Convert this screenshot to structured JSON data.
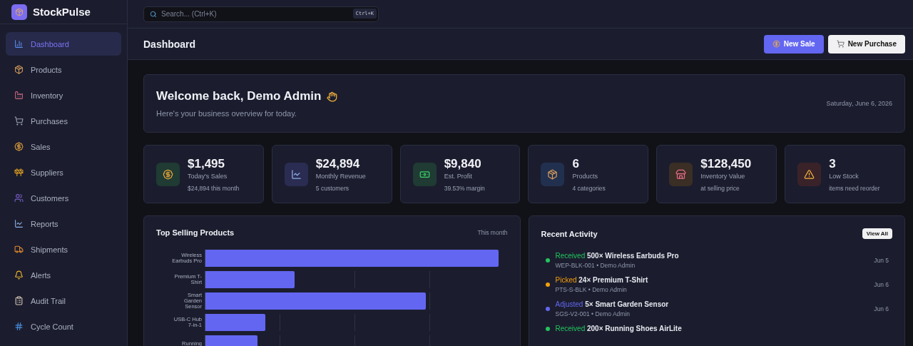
{
  "app": {
    "name": "StockPulse"
  },
  "sidebar": {
    "items": [
      {
        "label": "Dashboard",
        "selected": true
      },
      {
        "label": "Products",
        "selected": false
      },
      {
        "label": "Inventory",
        "selected": false
      },
      {
        "label": "Purchases",
        "selected": false
      },
      {
        "label": "Sales",
        "selected": false
      },
      {
        "label": "Suppliers",
        "selected": false
      },
      {
        "label": "Customers",
        "selected": false
      },
      {
        "label": "Reports",
        "selected": false
      },
      {
        "label": "Shipments",
        "selected": false
      },
      {
        "label": "Alerts",
        "selected": false
      },
      {
        "label": "Audit Trail",
        "selected": false
      },
      {
        "label": "Cycle Count",
        "selected": false
      }
    ]
  },
  "search": {
    "placeholder": "Search... (Ctrl+K)",
    "shortcut": "Ctrl+K"
  },
  "header": {
    "title": "Dashboard",
    "buttons": [
      {
        "label": "New Sale",
        "kind": "primary"
      },
      {
        "label": "New Purchase",
        "kind": "secondary"
      }
    ]
  },
  "welcome": {
    "title": "Welcome back, Demo Admin",
    "subtitle": "Here's your business overview for today.",
    "date": "Saturday, June 6, 2026"
  },
  "stats": [
    {
      "value": "$1,495",
      "label": "Today's Sales",
      "note": "$24,894 this month",
      "color": "#1f3b33"
    },
    {
      "value": "$24,894",
      "label": "Monthly Revenue",
      "note": "5 customers",
      "color": "#2a2c52"
    },
    {
      "value": "$9,840",
      "label": "Est. Profit",
      "note": "39.53% margin",
      "color": "#1f3b33"
    },
    {
      "value": "6",
      "label": "Products",
      "note": "4 categories",
      "color": "#22304f"
    },
    {
      "value": "$128,450",
      "label": "Inventory Value",
      "note": "at selling price",
      "color": "#3a2e25"
    },
    {
      "value": "3",
      "label": "Low Stock",
      "note": "items need reorder",
      "color": "#3a2229"
    }
  ],
  "top_selling": {
    "title": "Top Selling Products",
    "period": "This month",
    "labels": [
      "Wireless Earbuds Pro",
      "Premium T-Shirt",
      "Smart Garden Sensor",
      "USB-C Hub 7-in-1",
      "Running"
    ]
  },
  "activity": {
    "title": "Recent Activity",
    "button": "View All",
    "items": [
      {
        "action": "Received",
        "text": "500× Wireless Earbuds Pro",
        "meta": "WEP-BLK-001 • Demo Admin",
        "date": "Jun 5",
        "color": "#22c55e"
      },
      {
        "action": "Picked",
        "text": "24× Premium T-Shirt",
        "meta": "PTS-S-BLK • Demo Admin",
        "date": "Jun 6",
        "color": "#f59e0b"
      },
      {
        "action": "Adjusted",
        "text": "5× Smart Garden Sensor",
        "meta": "SGS-V2-001 • Demo Admin",
        "date": "Jun 6",
        "color": "#6366f1"
      },
      {
        "action": "Received",
        "text": "200× Running Shoes AirLite",
        "color": "#22c55e"
      }
    ]
  }
}
